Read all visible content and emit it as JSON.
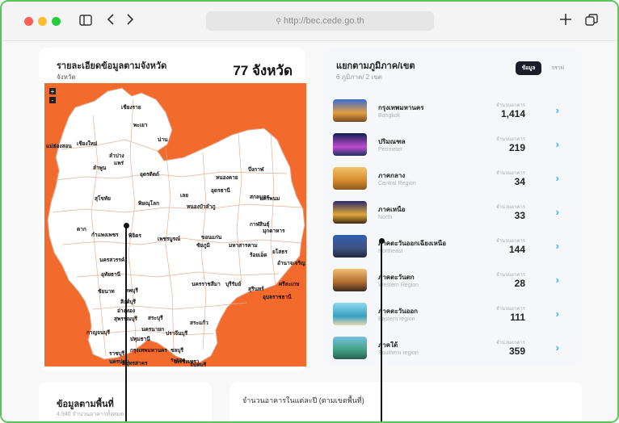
{
  "browser": {
    "url": "http://bec.cede.go.th"
  },
  "map_panel": {
    "title": "รายละเอียดข้อมูลตามจังหวัด",
    "subtitle": "จังหวัด",
    "count": "77 จังหวัด",
    "zoom_in": "+",
    "zoom_out": "-",
    "provinces": [
      "เชียงราย",
      "พะเยา",
      "น่าน",
      "แม่ฮ่องสอน",
      "เชียงใหม่",
      "ลำปาง",
      "แพร่",
      "ลำพูน",
      "อุตรดิตถ์",
      "สุโขทัย",
      "พิษณุโลก",
      "ตาก",
      "กำแพงเพชร",
      "พิจิตร",
      "เพชรบูรณ์",
      "นครสวรรค์",
      "อุทัยธานี",
      "ชัยนาท",
      "ลพบุรี",
      "ชัยภูมิ",
      "สิงห์บุรี",
      "อ่างทอง",
      "สุพรรณบุรี",
      "กาญจนบุรี",
      "สระบุรี",
      "นครนายก",
      "ปทุมธานี",
      "กรุงเทพมหานคร",
      "ปราจีนบุรี",
      "สระแก้ว",
      "ราชบุรี",
      "นครปฐม",
      "สมุทรสาคร",
      "ฉะเชิงเทรา",
      "ชลบุรี",
      "ระยอง",
      "จันทบุรี",
      "เพชรบุรี",
      "เลย",
      "หนองบัวลำภู",
      "อุดรธานี",
      "หนองคาย",
      "บึงกาฬ",
      "สกลนคร",
      "นครพนม",
      "กาฬสินธุ์",
      "มุกดาหาร",
      "ขอนแก่น",
      "มหาสารคาม",
      "ร้อยเอ็ด",
      "ยโสธร",
      "อำนาจเจริญ",
      "นครราชสีมา",
      "บุรีรัมย์",
      "สุรินทร์",
      "ศรีสะเกษ",
      "อุบลราชธานี"
    ]
  },
  "region_panel": {
    "title": "แยกตามภูมิภาค/เขต",
    "subtitle": "6 ภูมิภาค/ 2 เขต",
    "toggle_active": "ข้อมูล",
    "toggle_inactive": "กราฟ",
    "value_label": "จำนวนอาคาร",
    "regions": [
      {
        "name": "กรุงเทพมหานคร",
        "en": "Bangkok",
        "value": "1,414"
      },
      {
        "name": "ปริมณฑล",
        "en": "Perimeter",
        "value": "219"
      },
      {
        "name": "ภาคกลาง",
        "en": "Central Region",
        "value": "34"
      },
      {
        "name": "ภาคเหนือ",
        "en": "North",
        "value": "33"
      },
      {
        "name": "ภาคตะวันออกเฉียงเหนือ",
        "en": "Northeast",
        "value": "144"
      },
      {
        "name": "ภาคตะวันตก",
        "en": "Western Region",
        "value": "28"
      },
      {
        "name": "ภาคตะวันออก",
        "en": "Eastern region",
        "value": "111"
      },
      {
        "name": "ภาคใต้",
        "en": "Southern region",
        "value": "359"
      }
    ]
  },
  "area_panel": {
    "title": "ข้อมูลตามพื้นที่",
    "subtitle": "4,940 จำนวนอาคารทั้งหมด"
  },
  "yearly_panel": {
    "title": "จำนวนอาคารในแต่ละปี (ตามเขตพื้นที่)"
  },
  "colors": {
    "accent": "#30b4ff",
    "map_bg": "#f26b2c",
    "frame": "#5cc45a"
  }
}
